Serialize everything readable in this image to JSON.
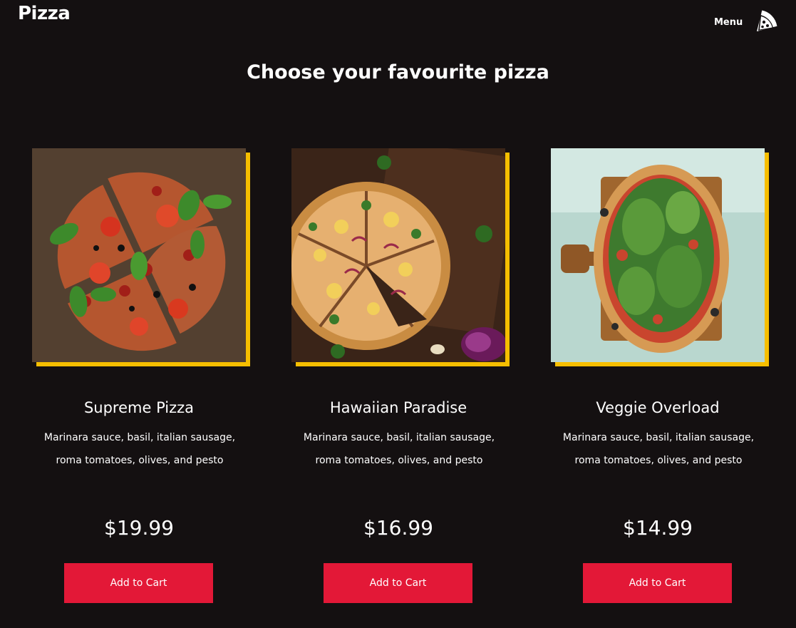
{
  "nav": {
    "logo": "Pizza",
    "menu_label": "Menu",
    "menu_icon": "pizza-slice-icon"
  },
  "heading": "Choose your favourite pizza",
  "colors": {
    "background": "#141011",
    "accent_shadow": "#f6be00",
    "button": "#e31837",
    "text": "#ffffff"
  },
  "pizzas": [
    {
      "name": "Supreme Pizza",
      "description": "Marinara sauce, basil, italian sausage, roma tomatoes, olives, and pesto",
      "price": "$19.99",
      "button_label": "Add to Cart",
      "image_alt": "supreme-pizza-photo"
    },
    {
      "name": "Hawaiian Paradise",
      "description": "Marinara sauce, basil, italian sausage, roma tomatoes, olives, and pesto",
      "price": "$16.99",
      "button_label": "Add to Cart",
      "image_alt": "hawaiian-pizza-photo"
    },
    {
      "name": "Veggie Overload",
      "description": "Marinara sauce, basil, italian sausage, roma tomatoes, olives, and pesto",
      "price": "$14.99",
      "button_label": "Add to Cart",
      "image_alt": "veggie-pizza-photo"
    }
  ]
}
